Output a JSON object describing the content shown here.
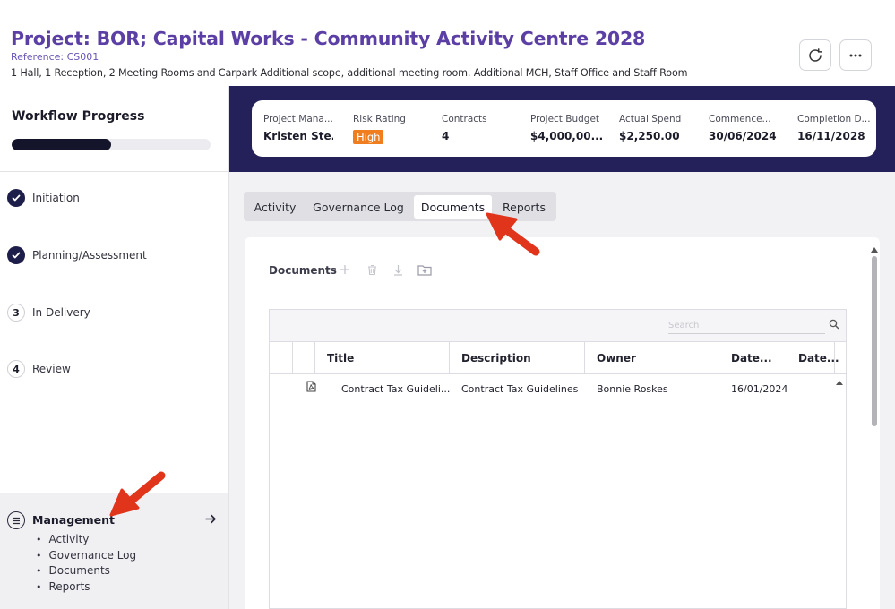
{
  "header": {
    "title": "Project: BOR; Capital Works - Community Activity Centre 2028",
    "reference": "Reference: CS001",
    "scope": "1 Hall, 1 Reception, 2 Meeting Rooms and Carpark Additional scope, additional meeting room. Additional MCH, Staff Office and Staff Room",
    "refresh_icon": "refresh-icon",
    "more_icon": "more-horizontal-icon"
  },
  "sidebar": {
    "workflow_title": "Workflow Progress",
    "workflow_progress": 0.5,
    "steps": [
      {
        "label": "Initiation",
        "status": "complete"
      },
      {
        "label": "Planning/Assessment",
        "status": "complete"
      },
      {
        "label": "In Delivery",
        "number": "3",
        "status": "pending"
      },
      {
        "label": "Review",
        "number": "4",
        "status": "pending"
      }
    ],
    "management": {
      "title": "Management",
      "items": [
        "Activity",
        "Governance Log",
        "Documents",
        "Reports"
      ]
    }
  },
  "summary": {
    "project_manager": {
      "label": "Project Mana...",
      "value": "Kristen Ste..."
    },
    "risk_rating": {
      "label": "Risk Rating",
      "value": "High"
    },
    "contracts": {
      "label": "Contracts",
      "value": "4"
    },
    "project_budget": {
      "label": "Project Budget",
      "value": "$4,000,00..."
    },
    "actual_spend": {
      "label": "Actual Spend",
      "value": "$2,250.00"
    },
    "commencement": {
      "label": "Commence...",
      "value": "30/06/2024"
    },
    "completion": {
      "label": "Completion D...",
      "value": "16/11/2028"
    }
  },
  "tabs": [
    {
      "label": "Activity",
      "active": false
    },
    {
      "label": "Governance Log",
      "active": false
    },
    {
      "label": "Documents",
      "active": true
    },
    {
      "label": "Reports",
      "active": false
    }
  ],
  "documents": {
    "title": "Documents",
    "search_placeholder": "Search",
    "columns": [
      "Title",
      "Description",
      "Owner",
      "Date...",
      "Date..."
    ],
    "rows": [
      {
        "title": "Contract Tax Guideli...",
        "description": "Contract Tax Guidelines",
        "owner": "Bonnie Roskes",
        "date1": "16/01/2024",
        "date2": ""
      }
    ]
  },
  "colors": {
    "title_purple": "#5b3fa5",
    "banner_navy": "#24205a",
    "risk_high": "#f07d1e",
    "annotation_red": "#e0341b"
  }
}
